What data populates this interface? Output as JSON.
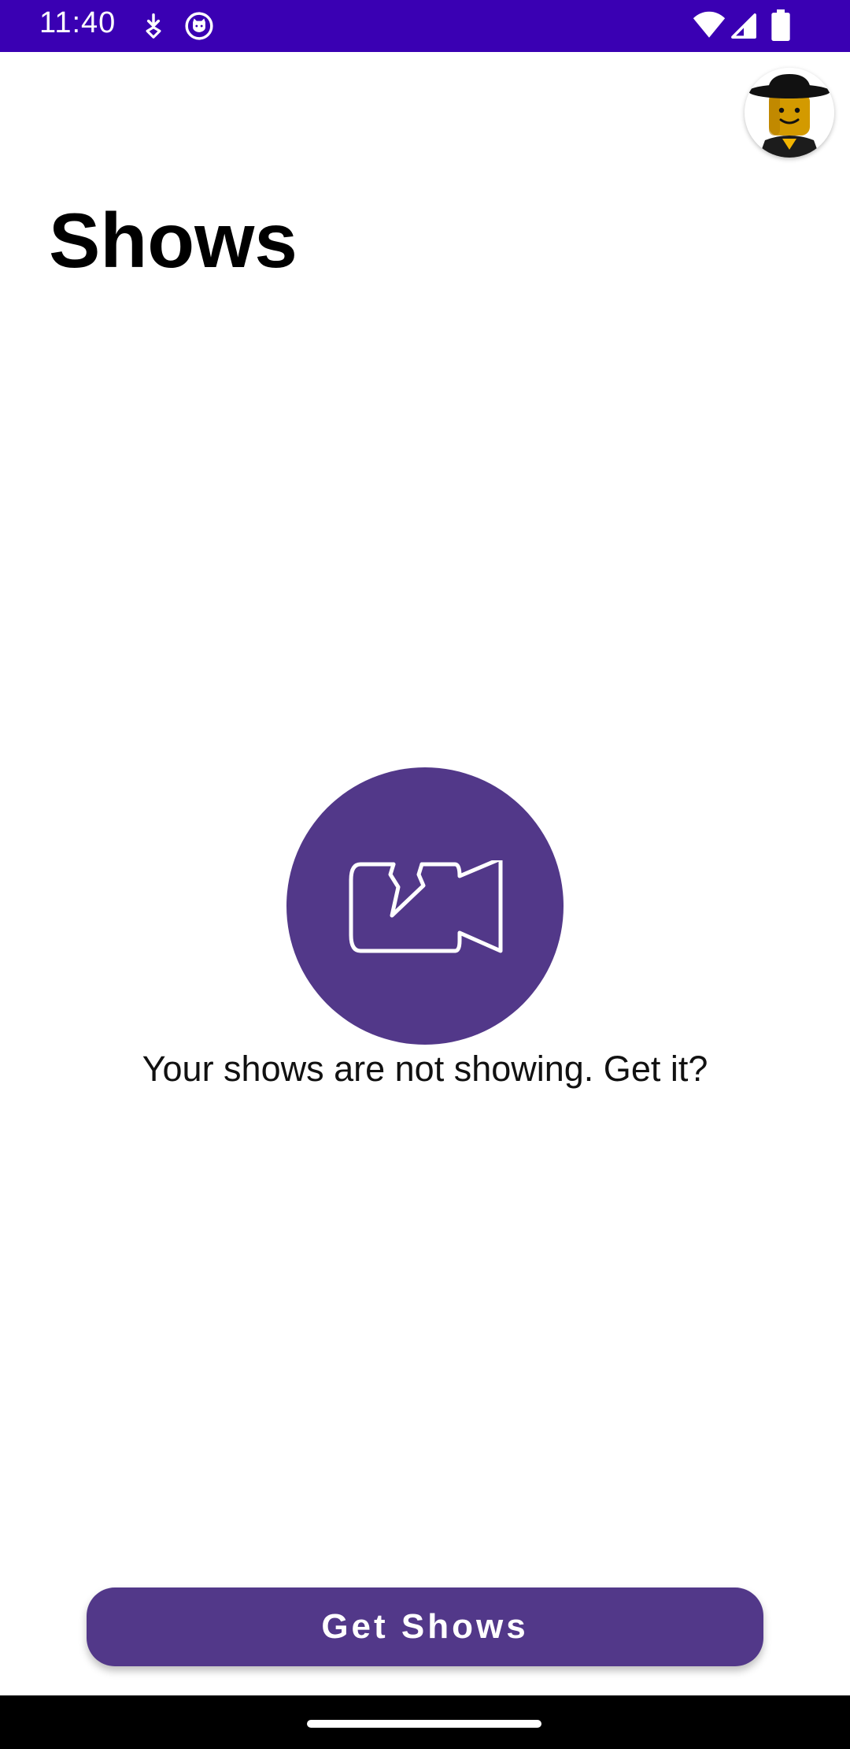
{
  "status_bar": {
    "time": "11:40",
    "background": "#3a00b3",
    "notification_icons": [
      "download-icon",
      "cat-face-icon"
    ],
    "system_icons": [
      "wifi-icon",
      "signal-icon",
      "battery-icon"
    ]
  },
  "header": {
    "title": "Shows",
    "avatar_icon": "lego-minifigure-avatar"
  },
  "empty_state": {
    "icon": "camera-off-icon",
    "message": "Your shows are not showing. Get it?",
    "accent": "#523889"
  },
  "actions": {
    "get_shows_label": "Get Shows",
    "button_color": "#523889"
  }
}
